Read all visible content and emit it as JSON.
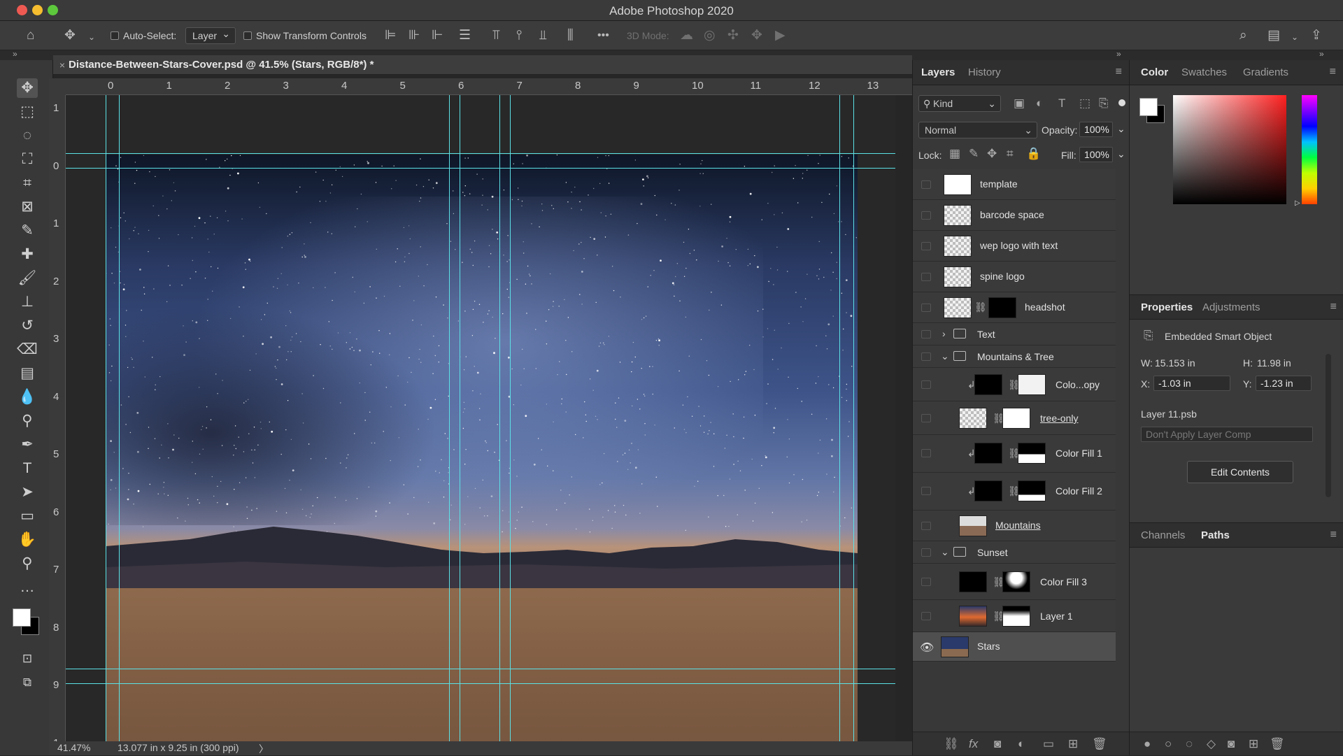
{
  "app_title": "Adobe Photoshop 2020",
  "window_controls": {
    "close_color": "#ee5a52",
    "minimize_color": "#f5bd2f",
    "maximize_color": "#5dc83c"
  },
  "options_bar": {
    "auto_select_label": "Auto-Select:",
    "auto_select_value": "Layer",
    "transform_controls_label": "Show Transform Controls",
    "mode_3d_label": "3D Mode:",
    "more_label": "•••"
  },
  "document": {
    "tab_title": "Distance-Between-Stars-Cover.psd @ 41.5% (Stars, RGB/8*) *",
    "zoom": "41.47%",
    "doc_size": "13.077 in x 9.25 in (300 ppi)"
  },
  "rulers": {
    "horizontal": [
      "0",
      "1",
      "2",
      "3",
      "4",
      "5",
      "6",
      "7",
      "8",
      "9",
      "10",
      "11",
      "12",
      "13"
    ],
    "vertical": [
      "1",
      "0",
      "1",
      "2",
      "3",
      "4",
      "5",
      "6",
      "7",
      "8",
      "9",
      "1"
    ]
  },
  "layers_panel": {
    "tabs": [
      "Layers",
      "History"
    ],
    "filter_kind": "Kind",
    "blend_mode": "Normal",
    "opacity_label": "Opacity:",
    "opacity": "100%",
    "lock_label": "Lock:",
    "fill_label": "Fill:",
    "fill": "100%",
    "layers": [
      {
        "name": "template"
      },
      {
        "name": "barcode space"
      },
      {
        "name": "wep logo with text"
      },
      {
        "name": "spine logo"
      },
      {
        "name": "headshot"
      },
      {
        "name": "Text"
      },
      {
        "name": "Mountains & Tree"
      },
      {
        "name": "Colo...opy"
      },
      {
        "name": "tree-only"
      },
      {
        "name": "Color Fill 1"
      },
      {
        "name": "Color Fill 2"
      },
      {
        "name": "Mountains"
      },
      {
        "name": "Sunset"
      },
      {
        "name": "Color Fill 3"
      },
      {
        "name": "Layer 1"
      },
      {
        "name": "Stars"
      }
    ]
  },
  "color_panel": {
    "tabs": [
      "Color",
      "Swatches",
      "Gradients"
    ],
    "foreground": "#ffffff",
    "background": "#000000"
  },
  "properties_panel": {
    "tabs": [
      "Properties",
      "Adjustments"
    ],
    "type": "Embedded Smart Object",
    "w_label": "W:",
    "w": "15.153 in",
    "h_label": "H:",
    "h": "11.98 in",
    "x_label": "X:",
    "x": "-1.03 in",
    "y_label": "Y:",
    "y": "-1.23 in",
    "source": "Layer 11.psb",
    "layer_comp": "Don't Apply Layer Comp",
    "edit_button": "Edit Contents"
  },
  "paths_panel": {
    "tabs": [
      "Channels",
      "Paths"
    ]
  },
  "status_arrow": "〉"
}
